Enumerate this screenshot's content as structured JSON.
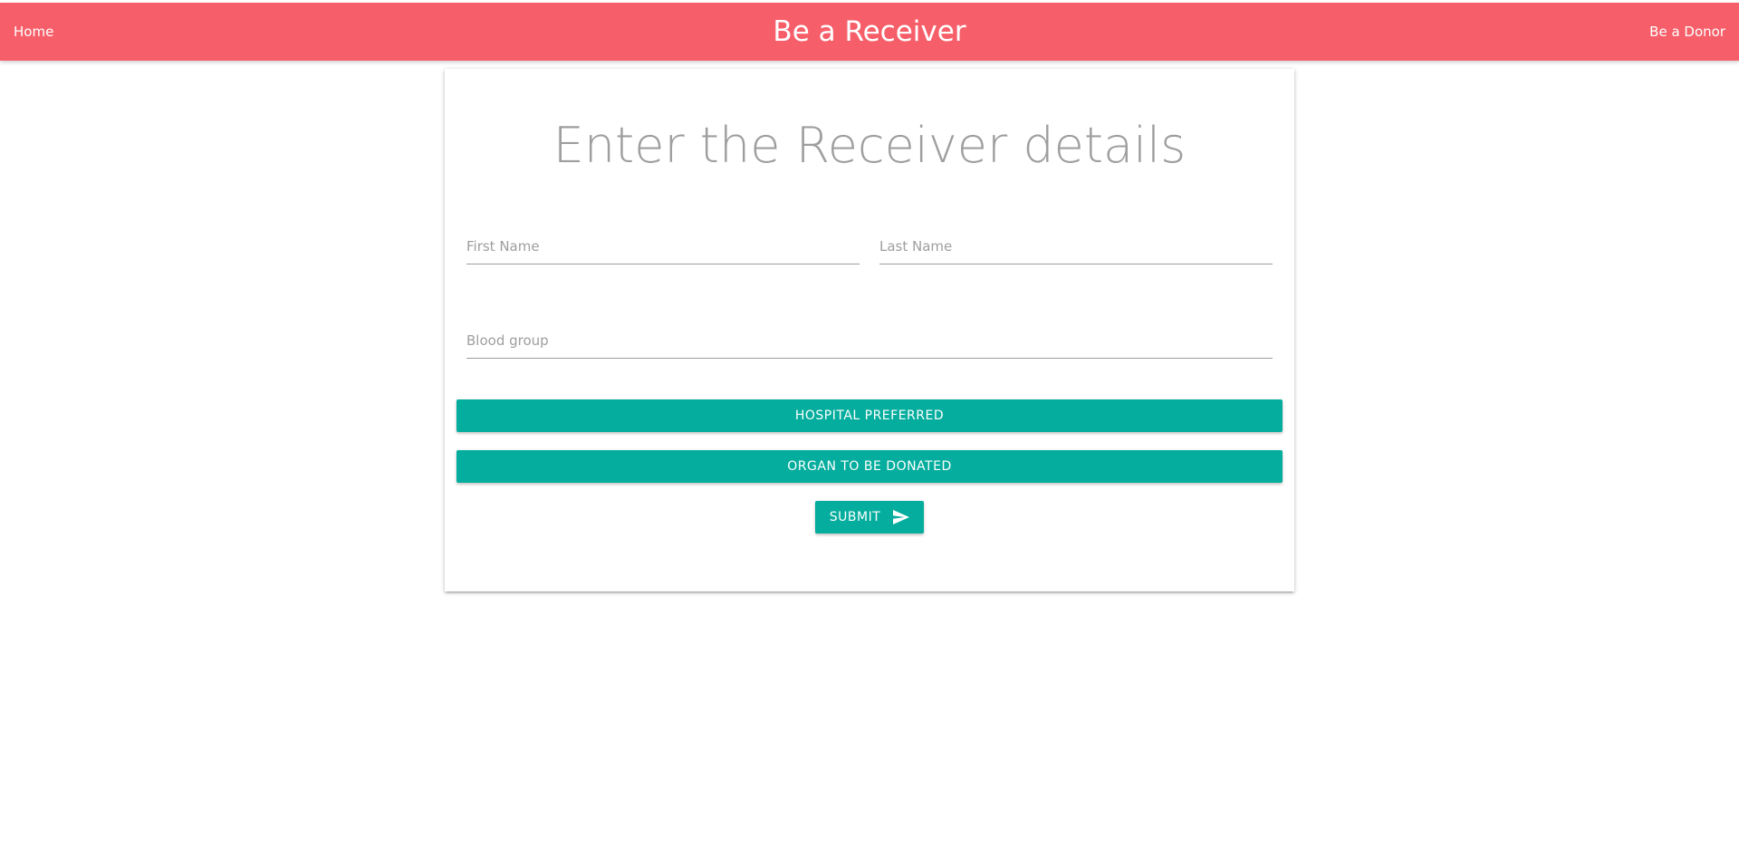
{
  "navbar": {
    "home_label": "Home",
    "title": "Be a Receiver",
    "donor_label": "Be a Donor",
    "background_color": "#f65f69"
  },
  "form": {
    "heading": "Enter the Receiver details",
    "first_name_placeholder": "First Name",
    "first_name_value": "",
    "last_name_placeholder": "Last Name",
    "last_name_value": "",
    "blood_group_placeholder": "Blood group",
    "blood_group_value": "",
    "hospital_button_label": "HOSPITAL PREFERRED",
    "organ_button_label": "ORGAN TO BE DONATED",
    "submit_label": "SUBMIT",
    "submit_icon": "send-icon",
    "accent_color": "#04ad9d"
  }
}
